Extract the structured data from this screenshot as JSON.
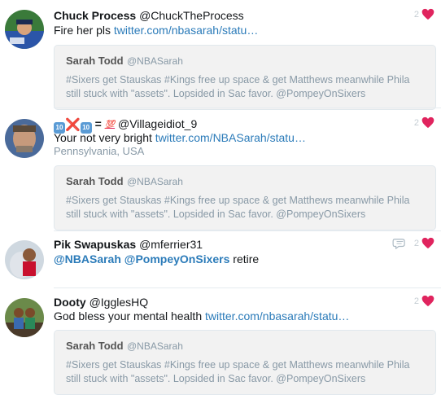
{
  "tweets": [
    {
      "name": "Chuck Process",
      "handle": "@ChuckTheProcess",
      "text": "Fire her pls",
      "link": "twitter.com/nbasarah/statu…",
      "likes": "2",
      "quote": {
        "name": "Sarah Todd",
        "handle": "@NBASarah",
        "text": "#Sixers get Stauskas #Kings free up space & get Matthews meanwhile Phila still stuck with \"assets\". Lopsided in Sac favor. @PompeyOnSixers"
      }
    },
    {
      "name_emoji": [
        "10",
        "❌",
        "10",
        "=",
        "💯"
      ],
      "handle": "@Villageidiot_9",
      "text": "Your not very bright",
      "link": "twitter.com/NBASarah/statu…",
      "location": "Pennsylvania, USA",
      "likes": "2",
      "quote": {
        "name": "Sarah Todd",
        "handle": "@NBASarah",
        "text": "#Sixers get Stauskas #Kings free up space & get Matthews meanwhile Phila still stuck with \"assets\". Lopsided in Sac favor. @PompeyOnSixers"
      }
    },
    {
      "name": "Pik Swapuskas",
      "handle": "@mferrier31",
      "mention1": "@NBASarah",
      "mention2": "@PompeyOnSixers",
      "text": "retire",
      "likes": "2"
    },
    {
      "name": "Dooty",
      "handle": "@IgglesHQ",
      "text": "God bless your mental health",
      "link": "twitter.com/nbasarah/statu…",
      "likes": "2",
      "quote": {
        "name": "Sarah Todd",
        "handle": "@NBASarah",
        "text": "#Sixers get Stauskas #Kings free up space & get Matthews meanwhile Phila still stuck with \"assets\". Lopsided in Sac favor. @PompeyOnSixers"
      }
    }
  ],
  "colors": {
    "link": "#2b7bb9",
    "heart": "#e0245e",
    "quote_bg": "#f2f2f2"
  },
  "icons": [
    "heart-icon",
    "reply-icon"
  ]
}
